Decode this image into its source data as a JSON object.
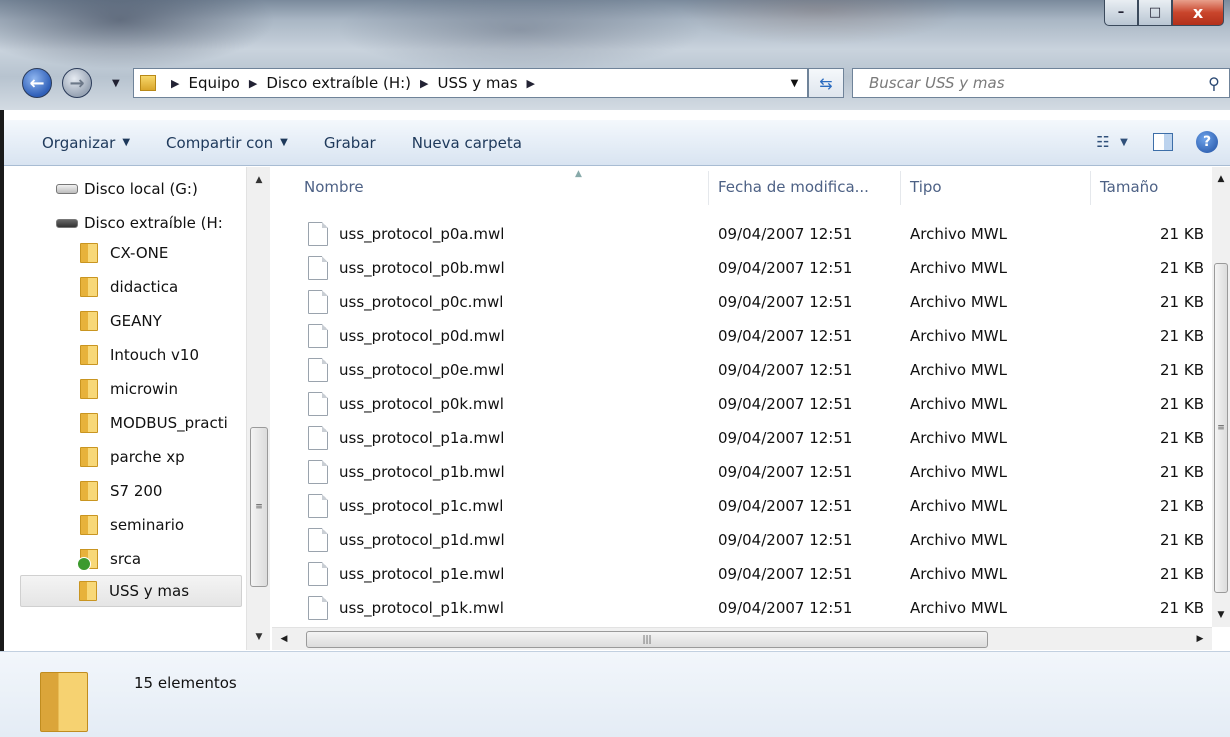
{
  "window": {
    "minimize": "–",
    "maximize": "□",
    "close": "x"
  },
  "address_bar": {
    "breadcrumbs": [
      "Equipo",
      "Disco extraíble (H:)",
      "USS y mas"
    ],
    "search_placeholder": "Buscar USS y mas"
  },
  "toolbar": {
    "organize": "Organizar",
    "share": "Compartir con",
    "burn": "Grabar",
    "new_folder": "Nueva carpeta"
  },
  "nav": {
    "items": [
      {
        "label": "Disco local (G:)",
        "icon": "drive-icon"
      },
      {
        "label": "Disco extraíble (H:",
        "icon": "removable-drive-icon"
      },
      {
        "label": "CX-ONE",
        "icon": "folder-icon"
      },
      {
        "label": "didactica",
        "icon": "folder-icon"
      },
      {
        "label": "GEANY",
        "icon": "folder-icon"
      },
      {
        "label": "Intouch v10",
        "icon": "folder-icon"
      },
      {
        "label": "microwin",
        "icon": "folder-icon"
      },
      {
        "label": "MODBUS_practi",
        "icon": "folder-icon"
      },
      {
        "label": "parche xp",
        "icon": "folder-icon"
      },
      {
        "label": "S7 200",
        "icon": "folder-icon"
      },
      {
        "label": "seminario",
        "icon": "folder-icon"
      },
      {
        "label": "srca",
        "icon": "shared-folder-icon"
      },
      {
        "label": "USS y mas",
        "icon": "folder-icon",
        "selected": true
      }
    ]
  },
  "list": {
    "columns": [
      "Nombre",
      "Fecha de modifica...",
      "Tipo",
      "Tamaño"
    ],
    "rows": [
      {
        "name": "uss_protocol_p0a.mwl",
        "date": "09/04/2007 12:51",
        "type": "Archivo MWL",
        "size": "21 KB"
      },
      {
        "name": "uss_protocol_p0b.mwl",
        "date": "09/04/2007 12:51",
        "type": "Archivo MWL",
        "size": "21 KB"
      },
      {
        "name": "uss_protocol_p0c.mwl",
        "date": "09/04/2007 12:51",
        "type": "Archivo MWL",
        "size": "21 KB"
      },
      {
        "name": "uss_protocol_p0d.mwl",
        "date": "09/04/2007 12:51",
        "type": "Archivo MWL",
        "size": "21 KB"
      },
      {
        "name": "uss_protocol_p0e.mwl",
        "date": "09/04/2007 12:51",
        "type": "Archivo MWL",
        "size": "21 KB"
      },
      {
        "name": "uss_protocol_p0k.mwl",
        "date": "09/04/2007 12:51",
        "type": "Archivo MWL",
        "size": "21 KB"
      },
      {
        "name": "uss_protocol_p1a.mwl",
        "date": "09/04/2007 12:51",
        "type": "Archivo MWL",
        "size": "21 KB"
      },
      {
        "name": "uss_protocol_p1b.mwl",
        "date": "09/04/2007 12:51",
        "type": "Archivo MWL",
        "size": "21 KB"
      },
      {
        "name": "uss_protocol_p1c.mwl",
        "date": "09/04/2007 12:51",
        "type": "Archivo MWL",
        "size": "21 KB"
      },
      {
        "name": "uss_protocol_p1d.mwl",
        "date": "09/04/2007 12:51",
        "type": "Archivo MWL",
        "size": "21 KB"
      },
      {
        "name": "uss_protocol_p1e.mwl",
        "date": "09/04/2007 12:51",
        "type": "Archivo MWL",
        "size": "21 KB"
      },
      {
        "name": "uss_protocol_p1k.mwl",
        "date": "09/04/2007 12:51",
        "type": "Archivo MWL",
        "size": "21 KB"
      }
    ]
  },
  "details": {
    "count": "15 elementos"
  }
}
